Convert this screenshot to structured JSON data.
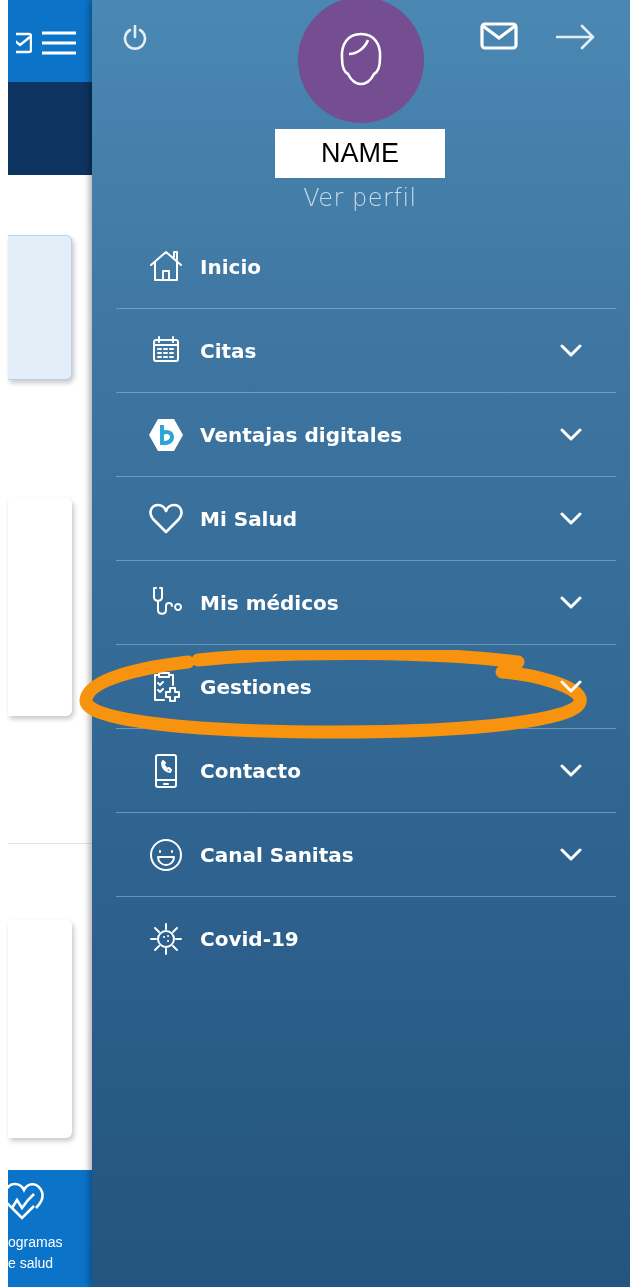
{
  "background_app": {
    "bottom_tab": {
      "label": "ogramas\ne salud"
    }
  },
  "drawer": {
    "user": {
      "name": "NAME",
      "profile_link": "Ver perfil"
    },
    "menu": [
      {
        "label": "Inicio",
        "kind": "home",
        "expandable": false
      },
      {
        "label": "Citas",
        "kind": "calendar",
        "expandable": true
      },
      {
        "label": "Ventajas digitales",
        "kind": "hexagon",
        "expandable": true
      },
      {
        "label": "Mi Salud",
        "kind": "heart",
        "expandable": true
      },
      {
        "label": "Mis médicos",
        "kind": "stethoscope",
        "expandable": true
      },
      {
        "label": "Gestiones",
        "kind": "clipboard",
        "expandable": true
      },
      {
        "label": "Contacto",
        "kind": "phone",
        "expandable": true
      },
      {
        "label": "Canal Sanitas",
        "kind": "smiley",
        "expandable": true
      },
      {
        "label": "Covid-19",
        "kind": "virus",
        "expandable": false
      }
    ]
  }
}
